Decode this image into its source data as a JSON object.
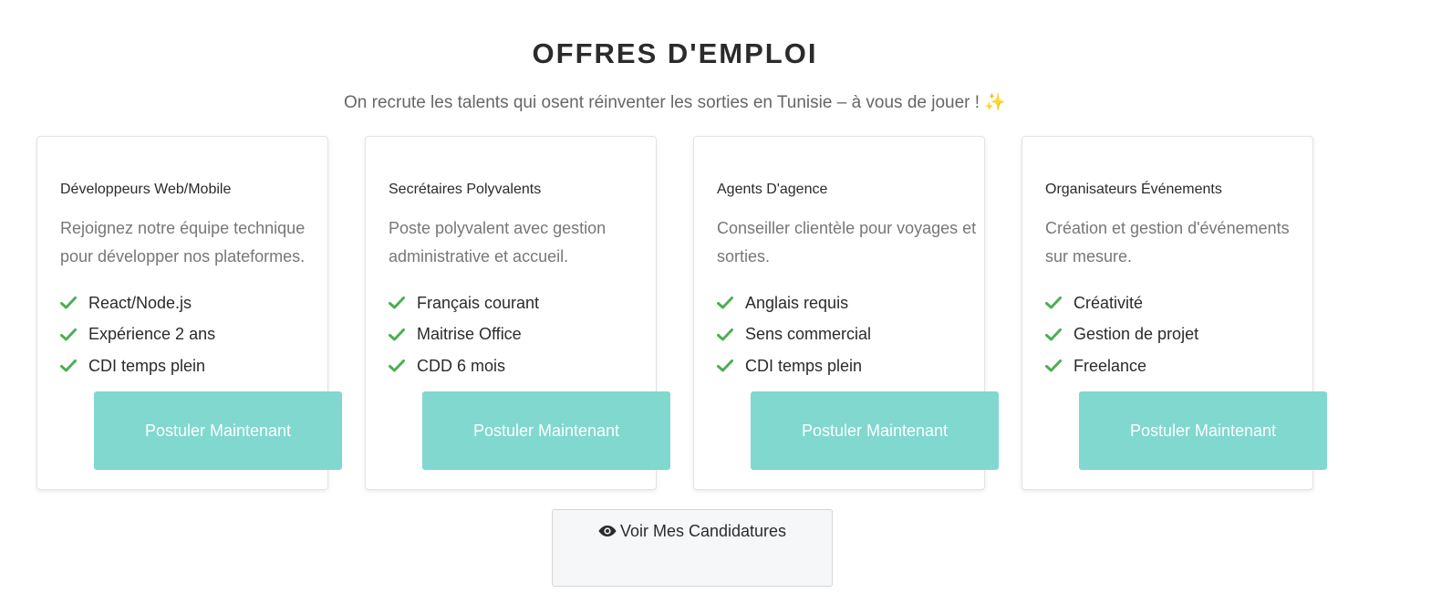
{
  "header": {
    "title": "OFFRES D'EMPLOI",
    "subtitle": "On recrute les talents qui osent réinventer les sorties en Tunisie – à vous de jouer !",
    "subtitle_emoji": "✨"
  },
  "accent_color": "#80d8cf",
  "check_color": "#4caf50",
  "jobs": [
    {
      "title": "Développeurs Web/Mobile",
      "description": "Rejoignez notre équipe technique pour développer nos plateformes.",
      "requirements": [
        "React/Node.js",
        "Expérience 2 ans",
        "CDI temps plein"
      ],
      "button_label": "Postuler Maintenant"
    },
    {
      "title": "Secrétaires Polyvalents",
      "description": "Poste polyvalent avec gestion administrative et accueil.",
      "requirements": [
        "Français courant",
        "Maitrise Office",
        "CDD 6 mois"
      ],
      "button_label": "Postuler Maintenant"
    },
    {
      "title": "Agents D'agence",
      "description": "Conseiller clientèle pour voyages et sorties.",
      "requirements": [
        "Anglais requis",
        "Sens commercial",
        "CDI temps plein"
      ],
      "button_label": "Postuler Maintenant"
    },
    {
      "title": "Organisateurs Événements",
      "description": "Création et gestion d'événements sur mesure.",
      "requirements": [
        "Créativité",
        "Gestion de projet",
        "Freelance"
      ],
      "button_label": "Postuler Maintenant"
    }
  ],
  "view_applications": {
    "icon": "eye-icon",
    "label": "Voir Mes Candidatures"
  }
}
